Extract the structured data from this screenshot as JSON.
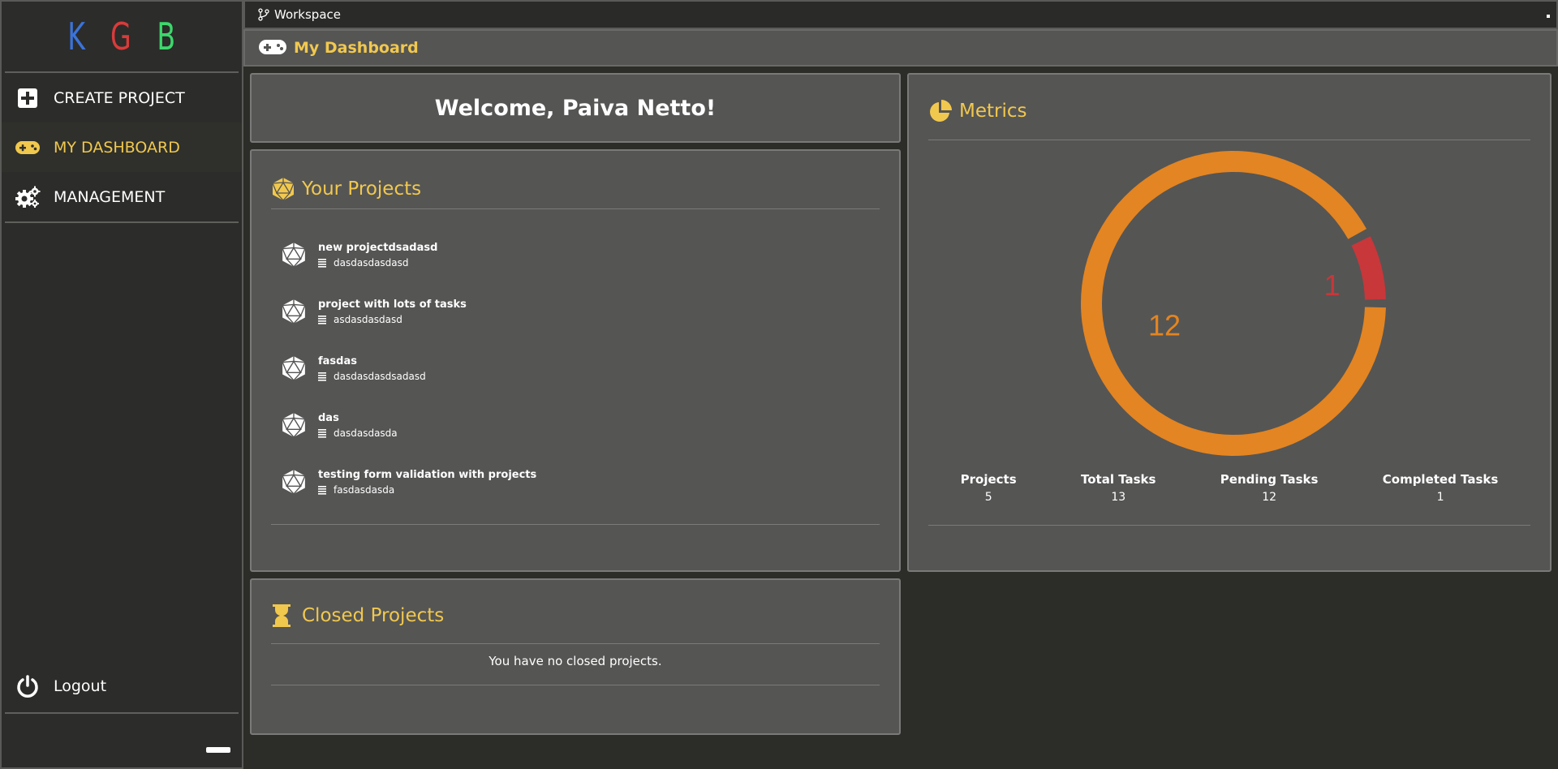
{
  "sidebar": {
    "logo": [
      "K",
      "G",
      "B"
    ],
    "items": [
      {
        "label": "CREATE PROJECT",
        "icon": "plus-square-icon"
      },
      {
        "label": "MY DASHBOARD",
        "icon": "gamepad-icon",
        "active": true
      },
      {
        "label": "MANAGEMENT",
        "icon": "gears-icon"
      }
    ],
    "logout_label": "Logout"
  },
  "workspace": {
    "label": "Workspace"
  },
  "header": {
    "title": "My Dashboard"
  },
  "welcome": {
    "text": "Welcome, Paiva Netto!"
  },
  "projects": {
    "title": "Your Projects",
    "items": [
      {
        "name": "new projectdsadasd",
        "description": "dasdasdasdasd"
      },
      {
        "name": "project with lots of tasks",
        "description": "asdasdasdasd"
      },
      {
        "name": "fasdas",
        "description": "dasdasdasdsadasd"
      },
      {
        "name": "das",
        "description": "dasdasdasda"
      },
      {
        "name": "testing form validation with projects",
        "description": "fasdasdasda"
      }
    ]
  },
  "closed": {
    "title": "Closed Projects",
    "message": "You have no closed projects."
  },
  "metrics": {
    "title": "Metrics",
    "stats": [
      {
        "label": "Projects",
        "value": "5"
      },
      {
        "label": "Total Tasks",
        "value": "13"
      },
      {
        "label": "Pending Tasks",
        "value": "12"
      },
      {
        "label": "Completed Tasks",
        "value": "1"
      }
    ]
  },
  "chart_data": {
    "type": "pie",
    "categories": [
      "Pending Tasks",
      "Completed Tasks"
    ],
    "values": [
      12,
      1
    ],
    "colors": [
      "#e38522",
      "#c8373a"
    ],
    "data_labels": [
      "12",
      "1"
    ]
  },
  "colors": {
    "accent": "#f1c84e",
    "panel": "#555554",
    "background": "#2c2c28"
  }
}
